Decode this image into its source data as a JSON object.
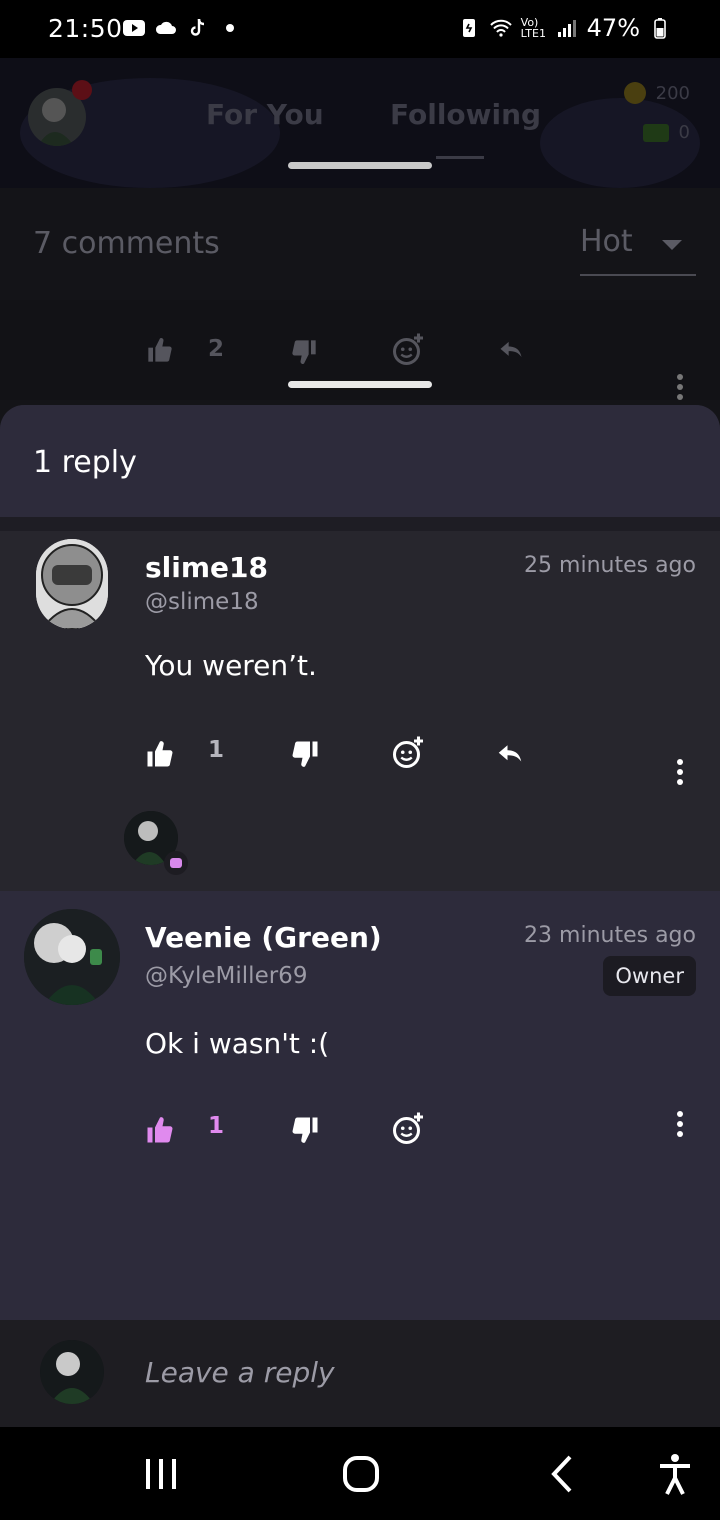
{
  "status_bar": {
    "time": "21:50",
    "battery": "47%",
    "network": "Vo) LTE1"
  },
  "header": {
    "tabs": [
      {
        "label": "For You"
      },
      {
        "label": "Following"
      }
    ],
    "coins": "200",
    "cash": "0"
  },
  "comments_sheet": {
    "count_label": "7 comments",
    "sort_label": "Hot",
    "parent_like_count": "2"
  },
  "replies_panel": {
    "title": "1 reply",
    "comments": [
      {
        "username": "slime18",
        "handle": "@slime18",
        "time": "25 minutes ago",
        "body": "You weren’t.",
        "like_count": "1"
      },
      {
        "username": "Veenie (Green)",
        "handle": "@KyleMiller69",
        "time": "23 minutes ago",
        "badge": "Owner",
        "body": "Ok i wasn't :(",
        "like_count": "1"
      }
    ]
  },
  "reply_bar": {
    "placeholder": "Leave a reply"
  },
  "colors": {
    "accent": "#e08aee",
    "panel_bg": "#2d2b3b",
    "comment_bg": "#27262d"
  },
  "icons": [
    "youtube-icon",
    "cloud-icon",
    "tiktok-icon",
    "wifi-icon",
    "signal-icon",
    "battery-icon",
    "thumbs-up-icon",
    "thumbs-down-icon",
    "add-reaction-icon",
    "reply-icon",
    "more-vertical-icon"
  ]
}
